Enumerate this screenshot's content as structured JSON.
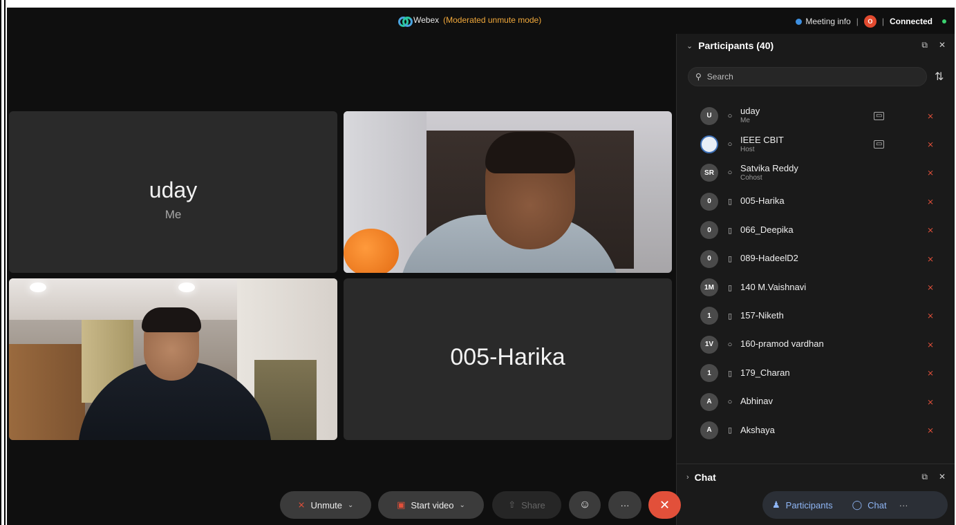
{
  "topbar": {
    "app_name": "Webex",
    "mode": "(Moderated unmute mode)",
    "meeting_info": "Meeting info",
    "record_badge": "O",
    "status": "Connected"
  },
  "tiles": [
    {
      "name": "uday",
      "sub": "Me"
    },
    {
      "name": "005-Harika"
    }
  ],
  "participants_panel": {
    "title": "Participants (40)",
    "search_placeholder": "Search",
    "participants": [
      {
        "initials": "U",
        "name": "uday",
        "role": "Me"
      },
      {
        "initials": "",
        "name": "IEEE CBIT",
        "role": "Host"
      },
      {
        "initials": "SR",
        "name": "Satvika Reddy",
        "role": "Cohost"
      },
      {
        "initials": "0",
        "name": "005-Harika",
        "role": ""
      },
      {
        "initials": "0",
        "name": "066_Deepika",
        "role": ""
      },
      {
        "initials": "0",
        "name": "089-HadeelD2",
        "role": ""
      },
      {
        "initials": "1M",
        "name": "140 M.Vaishnavi",
        "role": ""
      },
      {
        "initials": "1",
        "name": "157-Niketh",
        "role": ""
      },
      {
        "initials": "1V",
        "name": "160-pramod vardhan",
        "role": ""
      },
      {
        "initials": "1",
        "name": "179_Charan",
        "role": ""
      },
      {
        "initials": "A",
        "name": "Abhinav",
        "role": ""
      },
      {
        "initials": "A",
        "name": "Akshaya",
        "role": ""
      }
    ]
  },
  "chat_panel": {
    "title": "Chat"
  },
  "controls": {
    "unmute": "Unmute",
    "start_video": "Start video",
    "share": "Share",
    "more": "···",
    "leave": "✕",
    "participants": "Participants",
    "chat": "Chat",
    "overflow": "···"
  },
  "colors": {
    "accent": "#8fb6f5",
    "mode": "#f2a93b",
    "leave": "#e2503a",
    "connected": "#3bd16f"
  }
}
